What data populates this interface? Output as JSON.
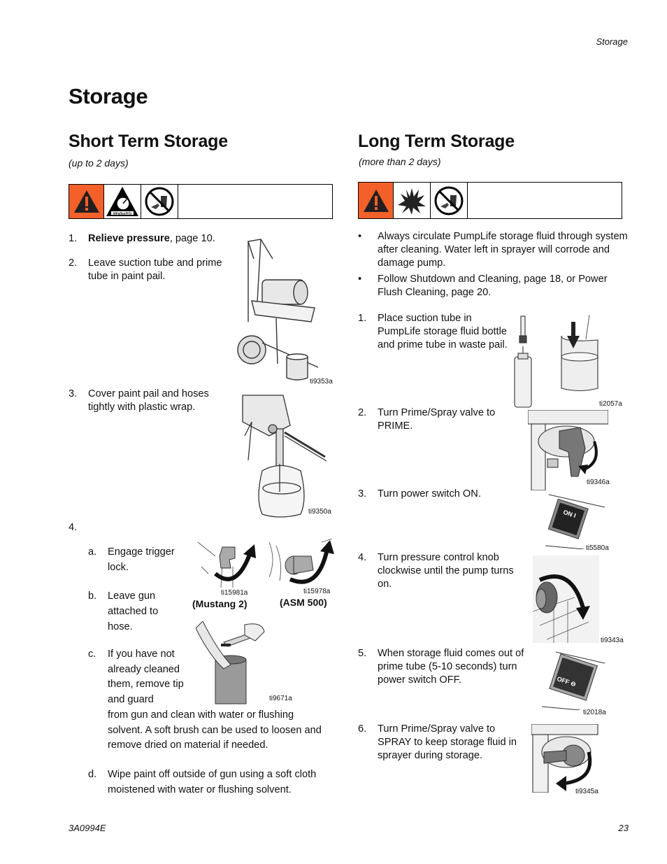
{
  "running_head": "Storage",
  "page_title": "Storage",
  "short_term": {
    "title": "Short Term Storage",
    "subtitle": "(up to 2 days)",
    "warning_icons": [
      "warning-triangle-icon",
      "pressure-gauge-icon",
      "no-hand-spray-icon"
    ],
    "steps": [
      {
        "num": "1.",
        "bold": "Relieve pressure",
        "text": ", page 10."
      },
      {
        "num": "2.",
        "text": "Leave suction tube and prime tube in paint pail."
      },
      {
        "num": "3.",
        "text": "Cover paint pail and hoses tightly with plastic wrap."
      },
      {
        "num": "4.",
        "text": ""
      }
    ],
    "substeps": [
      {
        "letter": "a.",
        "text": "Engage trigger lock."
      },
      {
        "letter": "b.",
        "text": "Leave gun attached to hose."
      },
      {
        "letter": "c.",
        "text_head": "If you have not already cleaned them, remove tip and guard",
        "text_tail": "from gun and clean with water or flushing solvent. A soft brush can be used to loosen and remove dried on material if needed."
      },
      {
        "letter": "d.",
        "text": "Wipe paint off outside of gun using a soft cloth moistened with water or flushing solvent."
      }
    ],
    "figures": [
      {
        "id": "ti9353a"
      },
      {
        "id": "ti9350a"
      },
      {
        "id": "ti15981a",
        "caption": "(Mustang 2)"
      },
      {
        "id": "ti15978a",
        "caption": "(ASM 500)"
      },
      {
        "id": "ti9671a"
      }
    ]
  },
  "long_term": {
    "title": "Long Term Storage",
    "subtitle": "(more than 2 days)",
    "warning_icons": [
      "warning-triangle-icon",
      "explosion-icon",
      "no-hand-spray-icon"
    ],
    "bullets": [
      "Always circulate PumpLife storage fluid through system after cleaning. Water left in sprayer will corrode and damage pump.",
      "Follow Shutdown and Cleaning, page 18, or Power Flush Cleaning, page 20."
    ],
    "steps": [
      {
        "num": "1.",
        "text": "Place suction tube in PumpLife storage fluid bottle and prime tube in waste pail."
      },
      {
        "num": "2.",
        "text": "Turn Prime/Spray valve to PRIME."
      },
      {
        "num": "3.",
        "text": "Turn power switch ON."
      },
      {
        "num": "4.",
        "text": "Turn pressure control knob clockwise until the pump turns on."
      },
      {
        "num": "5.",
        "text": "When storage fluid comes out of prime tube (5-10 seconds) turn power switch OFF."
      },
      {
        "num": "6.",
        "text": "Turn Prime/Spray valve to SPRAY to keep storage fluid in sprayer during storage."
      }
    ],
    "figures": [
      {
        "id": "ti2057a"
      },
      {
        "id": "ti9346a"
      },
      {
        "id": "ti5580a",
        "label": "ON I"
      },
      {
        "id": "ti9343a"
      },
      {
        "id": "ti2018a",
        "label": "OFF ⊖"
      },
      {
        "id": "ti9345a"
      }
    ]
  },
  "footer": {
    "doc_number": "3A0994E",
    "page_number": "23"
  },
  "colors": {
    "warning_orange": "#f4602a",
    "text": "#111111"
  }
}
